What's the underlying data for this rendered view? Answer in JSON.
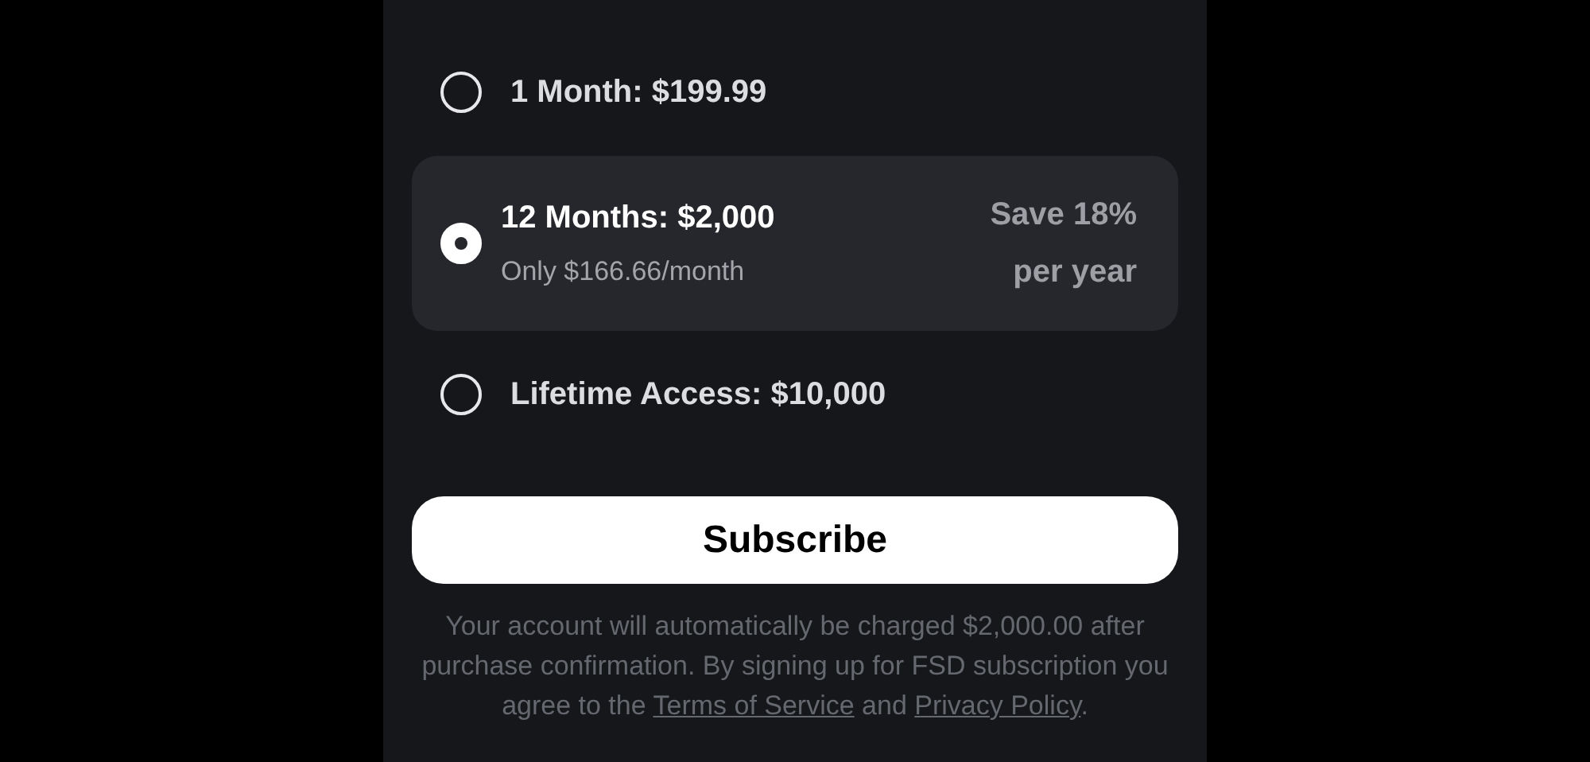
{
  "plans": [
    {
      "label": "1 Month: $199.99",
      "selected": false
    },
    {
      "label": "12 Months: $2,000",
      "sublabel": "Only $166.66/month",
      "savings": [
        "Save 18%",
        "per year"
      ],
      "selected": true
    },
    {
      "label": "Lifetime Access: $10,000",
      "selected": false
    }
  ],
  "subscribe_button": "Subscribe",
  "legal": {
    "text": "Your account will automatically be charged $2,000.00 after purchase confirmation. By signing up for FSD subscription you agree to the",
    "terms_link": "Terms of Service",
    "joiner": "and",
    "privacy_link": "Privacy Policy",
    "end": "."
  }
}
